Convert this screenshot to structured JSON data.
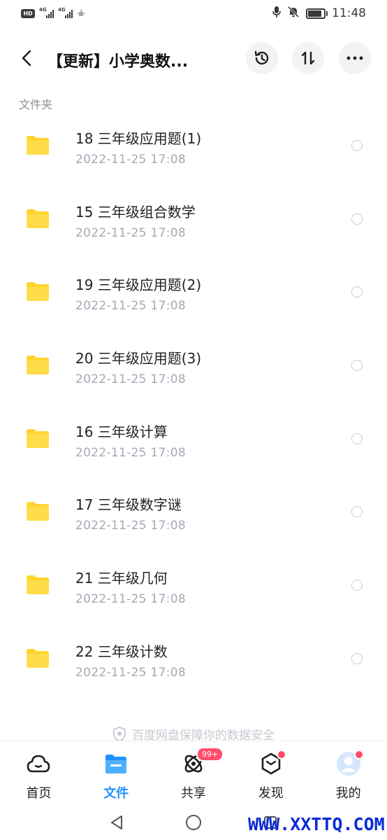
{
  "status_bar": {
    "time": "11:48",
    "hd_badge": "HD",
    "network_1": "4G",
    "network_2": "4G"
  },
  "header": {
    "title": "【更新】小学奥数...",
    "icons": {
      "back": "back-arrow-icon",
      "history": "history-icon",
      "sort": "sort-icon",
      "more": "more-icon"
    }
  },
  "section_label": "文件夹",
  "files": [
    {
      "name": "18 三年级应用题(1)",
      "date": "2022-11-25  17:08"
    },
    {
      "name": "15 三年级组合数学",
      "date": "2022-11-25  17:08"
    },
    {
      "name": "19 三年级应用题(2)",
      "date": "2022-11-25  17:08"
    },
    {
      "name": "20 三年级应用题(3)",
      "date": "2022-11-25  17:08"
    },
    {
      "name": "16 三年级计算",
      "date": "2022-11-25  17:08"
    },
    {
      "name": "17 三年级数字谜",
      "date": "2022-11-25  17:08"
    },
    {
      "name": "21 三年级几何",
      "date": "2022-11-25  17:08"
    },
    {
      "name": "22 三年级计数",
      "date": "2022-11-25  17:08"
    }
  ],
  "security_note": "百度网盘保障你的数据安全",
  "bottom_nav": [
    {
      "label": "首页",
      "icon": "cloud-home-icon",
      "active": false
    },
    {
      "label": "文件",
      "icon": "folder-icon",
      "active": true
    },
    {
      "label": "共享",
      "icon": "share-orbit-icon",
      "active": false,
      "badge": "99+"
    },
    {
      "label": "发现",
      "icon": "discover-box-icon",
      "active": false
    },
    {
      "label": "我的",
      "icon": "avatar-icon",
      "active": false
    }
  ],
  "watermark": "WWW.XXTTQ.COM",
  "colors": {
    "accent": "#1e90ff",
    "folder": "#ffd52e",
    "badge": "#ff4d6a",
    "watermark": "#0a2bd6"
  }
}
